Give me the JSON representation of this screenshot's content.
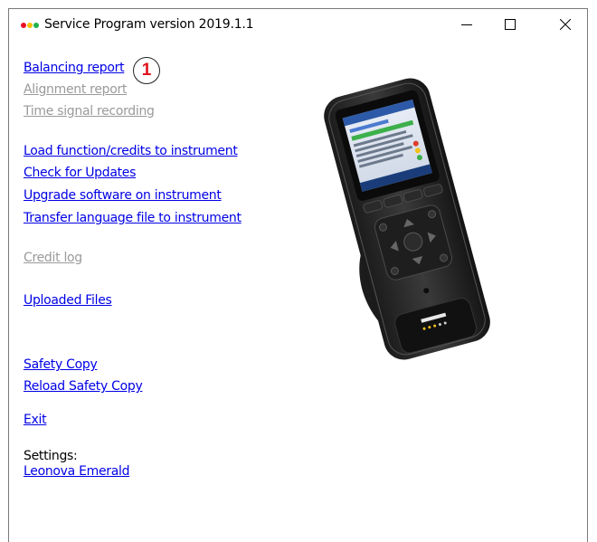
{
  "window": {
    "title": "Service Program version 2019.1.1",
    "icon_dots": [
      "#e81123",
      "#f5c000",
      "#22b14c"
    ]
  },
  "controls": {
    "minimize": "minimize",
    "maximize": "maximize",
    "close": "close"
  },
  "menu": {
    "balancing_report": "Balancing report",
    "alignment_report": "Alignment report",
    "time_signal_recording": "Time signal recording",
    "load_function": "Load function/credits to instrument",
    "check_updates": "Check for Updates",
    "upgrade_software": "Upgrade software on instrument",
    "transfer_language": "Transfer language file to instrument",
    "credit_log": "Credit log",
    "uploaded_files": "Uploaded Files",
    "safety_copy": "Safety Copy",
    "reload_safety_copy": "Reload Safety Copy",
    "exit": "Exit"
  },
  "settings": {
    "label": "Settings:",
    "value": "Leonova Emerald"
  },
  "marker": {
    "number": "1"
  },
  "colors": {
    "link": "#0000e6",
    "disabled": "#9a9a9a",
    "marker_text": "#e0121b"
  }
}
